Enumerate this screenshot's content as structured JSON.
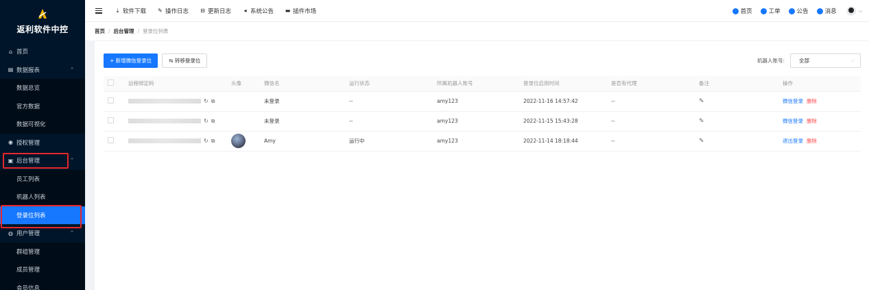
{
  "app": {
    "title": "返利软件中控"
  },
  "sidebar": {
    "items": [
      {
        "label": "首页",
        "icon": "home-icon",
        "level": 0
      },
      {
        "label": "数据报表",
        "icon": "report-icon",
        "level": 0,
        "expanded": true
      },
      {
        "label": "数据总览",
        "level": 1
      },
      {
        "label": "官方数据",
        "level": 1
      },
      {
        "label": "数据可视化",
        "level": 1
      },
      {
        "label": "授权管理",
        "icon": "shield-icon",
        "level": 0
      },
      {
        "label": "后台管理",
        "icon": "admin-icon",
        "level": 0,
        "expanded": true
      },
      {
        "label": "员工列表",
        "level": 1
      },
      {
        "label": "机器人列表",
        "level": 1
      },
      {
        "label": "登录位列表",
        "level": 1,
        "active": true
      },
      {
        "label": "用户管理",
        "icon": "users-icon",
        "level": 0,
        "expanded": true
      },
      {
        "label": "群组管理",
        "level": 1
      },
      {
        "label": "成员管理",
        "level": 1
      },
      {
        "label": "会员信息",
        "level": 1
      }
    ]
  },
  "topbar": {
    "nav": [
      {
        "label": "软件下载",
        "icon": "download-icon"
      },
      {
        "label": "操作日志",
        "icon": "log-icon"
      },
      {
        "label": "更新日志",
        "icon": "changelog-icon"
      },
      {
        "label": "系统公告",
        "icon": "announce-icon"
      },
      {
        "label": "插件市场",
        "icon": "plugin-icon"
      }
    ],
    "right": [
      {
        "label": "首页"
      },
      {
        "label": "工单"
      },
      {
        "label": "公告"
      },
      {
        "label": "消息"
      }
    ]
  },
  "breadcrumb": {
    "home": "首页",
    "parent": "后台管理",
    "current": "登录位列表"
  },
  "toolbar": {
    "add_label": "+ 新增微信登录位",
    "transfer_label": "⇆ 转移登录位"
  },
  "filter": {
    "label": "机器人账号:",
    "value": "全部"
  },
  "table": {
    "headers": [
      "远程绑定码",
      "头像",
      "微信名",
      "运行状态",
      "所属机器人账号",
      "登录位启用时间",
      "是否有代理",
      "备注",
      "操作"
    ],
    "rows": [
      {
        "wechat_name": "未登录",
        "status": "--",
        "robot": "amy123",
        "time": "2022-11-16 14:57:42",
        "proxy": "--",
        "actions": [
          "微信登录",
          "删除"
        ],
        "has_avatar": false
      },
      {
        "wechat_name": "未登录",
        "status": "--",
        "robot": "amy123",
        "time": "2022-11-15 15:43:28",
        "proxy": "--",
        "actions": [
          "微信登录",
          "删除"
        ],
        "has_avatar": false
      },
      {
        "wechat_name": "Amy",
        "status": "运行中",
        "robot": "amy123",
        "time": "2022-11-14 18:18:44",
        "proxy": "--",
        "actions": [
          "退出登录",
          "删除"
        ],
        "has_avatar": true
      }
    ]
  },
  "colors": {
    "primary": "#1677ff",
    "danger": "#ff4d4f",
    "sidebar_bg": "#001529",
    "highlight": "#e8272d"
  }
}
